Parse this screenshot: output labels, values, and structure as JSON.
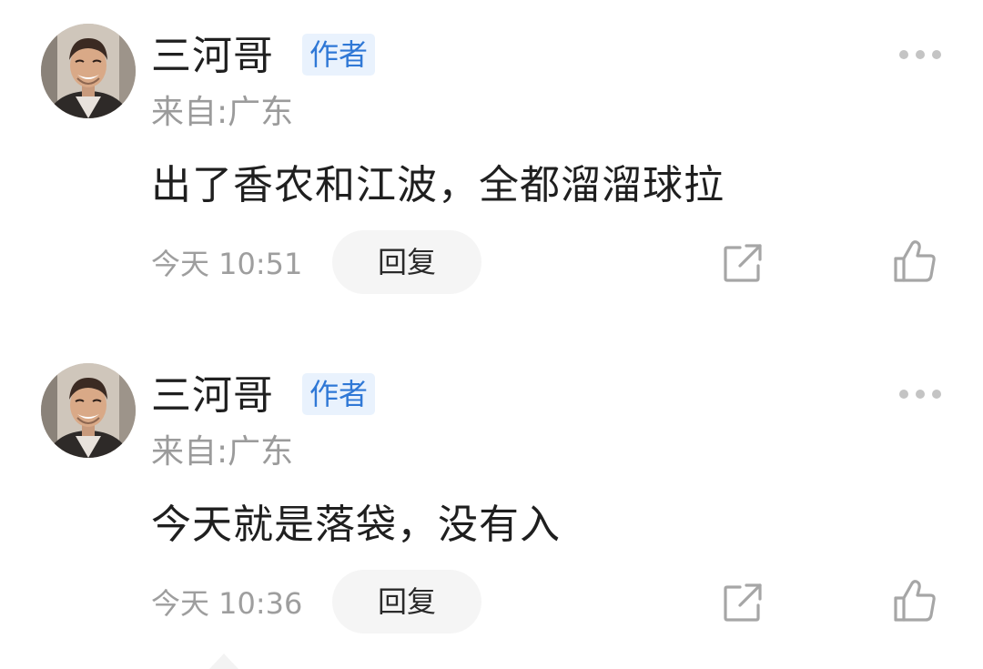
{
  "comments": [
    {
      "author": "三河哥",
      "badge": "作者",
      "location": "来自:广东",
      "text": "出了香农和江波，全都溜溜球拉",
      "time": "今天 10:51",
      "reply_label": "回复",
      "icons": {
        "more": "more-dots-icon",
        "share": "share-icon",
        "like": "thumbs-up-icon"
      }
    },
    {
      "author": "三河哥",
      "badge": "作者",
      "location": "来自:广东",
      "text": "今天就是落袋，没有入",
      "time": "今天 10:36",
      "reply_label": "回复",
      "icons": {
        "more": "more-dots-icon",
        "share": "share-icon",
        "like": "thumbs-up-icon"
      }
    }
  ],
  "colors": {
    "badge_text": "#2f78d6",
    "badge_bg": "#e9f2fd",
    "muted_text": "#9b9b9b",
    "reply_bg": "#f5f5f5"
  }
}
